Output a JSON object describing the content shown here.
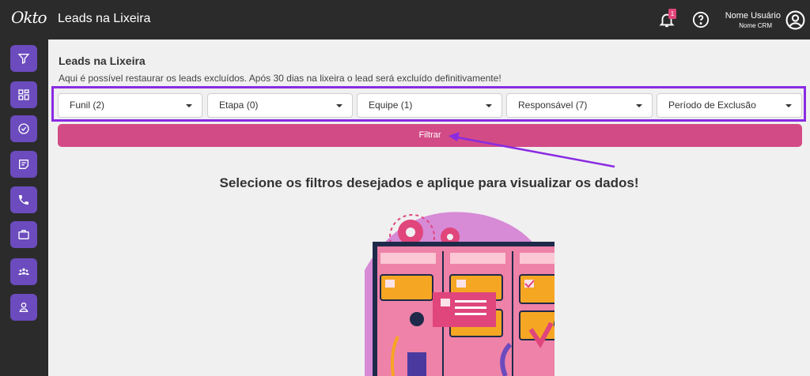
{
  "header": {
    "logo_text": "Okto",
    "title": "Leads na Lixeira",
    "notification_count": "1",
    "user_name": "Nome Usuário",
    "user_org": "Nome CRM"
  },
  "sidebar": {
    "items": [
      {
        "icon": "funnel-icon"
      },
      {
        "icon": "dashboard-icon"
      },
      {
        "icon": "check-circle-icon"
      },
      {
        "icon": "note-icon"
      },
      {
        "icon": "phone-icon"
      },
      {
        "icon": "briefcase-icon"
      },
      {
        "icon": "team-icon"
      },
      {
        "icon": "user-icon"
      }
    ]
  },
  "main": {
    "title": "Leads na Lixeira",
    "subtitle": "Aqui é possível restaurar os leads excluídos. Após 30 dias na lixeira o lead será excluído definitivamente!",
    "filters": [
      {
        "label": "Funil (2)"
      },
      {
        "label": "Etapa (0)"
      },
      {
        "label": "Equipe (1)"
      },
      {
        "label": "Responsável (7)"
      },
      {
        "label": "Período de Exclusão"
      }
    ],
    "filter_button": "Filtrar",
    "empty_prompt": "Selecione os filtros desejados e aplique para visualizar os dados!"
  },
  "colors": {
    "sidebar_button": "#6b4bbd",
    "filter_button": "#d24b86",
    "highlight_border": "#8a2be2"
  }
}
